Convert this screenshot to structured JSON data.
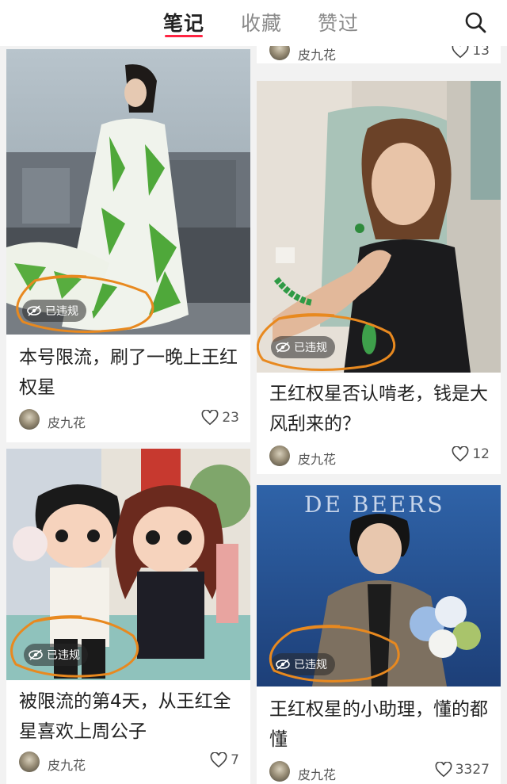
{
  "header": {
    "tabs": [
      {
        "label": "笔记",
        "active": true
      },
      {
        "label": "收藏",
        "active": false
      },
      {
        "label": "赞过",
        "active": false
      }
    ],
    "search_icon": "search-icon",
    "accent": "#ff2442"
  },
  "top_right_stub": {
    "author": "皮九花",
    "likes": "13"
  },
  "cards": [
    {
      "title": "本号限流，刷了一晚上王红权星",
      "author": "皮九花",
      "likes": "23",
      "badge": "已违规"
    },
    {
      "title": "王红权星否认啃老，钱是大风刮来的？",
      "author": "皮九花",
      "likes": "12",
      "badge": "已违规"
    },
    {
      "title": "被限流的第4天，从王红全星喜欢上周公子",
      "author": "皮九花",
      "likes": "7",
      "badge": "已违规"
    },
    {
      "title": "王红权星的小助理，懂的都懂",
      "author": "皮九花",
      "likes": "3327",
      "badge": "已违规"
    }
  ],
  "image_texts": {
    "brand_sign": "DE BEERS"
  }
}
